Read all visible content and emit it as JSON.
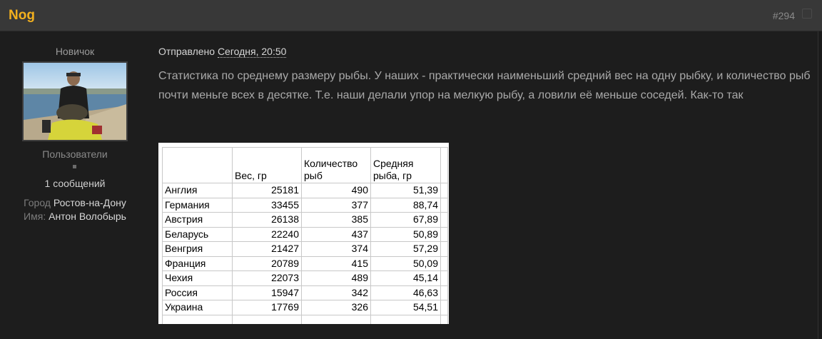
{
  "post": {
    "author": "Nog",
    "number": "#294",
    "posted_label": "Отправлено",
    "posted_date": "Сегодня, 20:50",
    "text": "Статистика по среднему размеру рыбы. У наших - практически наименьший средний вес на одну рыбку, и количество рыб почти меньге всех в десятке. Т.е. наши делали упор на мелкую рыбу, а ловили её меньше соседей. Как-то так"
  },
  "author_info": {
    "title": "Новичок",
    "group": "Пользователи",
    "posts": "1 сообщений",
    "city_label": "Город",
    "city": "Ростов-на-Дону",
    "name_label": "Имя:",
    "name": "Антон Волобырь"
  },
  "table": {
    "headers": [
      "",
      "Вес, гр",
      "Количество рыб",
      "Средняя рыба, гр"
    ],
    "rows": [
      [
        "Англия",
        "25181",
        "490",
        "51,39"
      ],
      [
        "Германия",
        "33455",
        "377",
        "88,74"
      ],
      [
        "Австрия",
        "26138",
        "385",
        "67,89"
      ],
      [
        "Беларусь",
        "22240",
        "437",
        "50,89"
      ],
      [
        "Венгрия",
        "21427",
        "374",
        "57,29"
      ],
      [
        "Франция",
        "20789",
        "415",
        "50,09"
      ],
      [
        "Чехия",
        "22073",
        "489",
        "45,14"
      ],
      [
        "Россия",
        "15947",
        "342",
        "46,63"
      ],
      [
        "Украина",
        "17769",
        "326",
        "54,51"
      ]
    ]
  },
  "colors": {
    "author": "#f2b01e",
    "header_bg": "#383838",
    "body_bg": "#1d1d1d"
  }
}
